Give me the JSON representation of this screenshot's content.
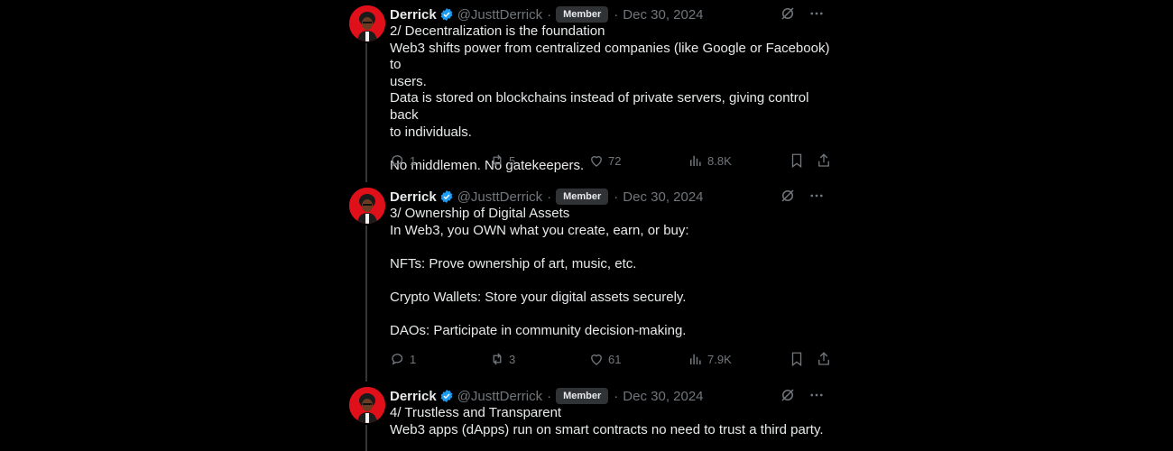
{
  "tweets": [
    {
      "name": "Derrick",
      "handle": "@JusttDerrick",
      "badge": "Member",
      "date": "Dec 30, 2024",
      "lines": [
        "2/ Decentralization is the foundation",
        "Web3 shifts power from centralized companies (like Google or Facebook) to",
        "users.",
        "Data is stored on blockchains instead of private servers, giving control back",
        "to individuals.",
        "",
        "No middlemen. No gatekeepers."
      ],
      "replies": "1",
      "reposts": "5",
      "likes": "72",
      "views": "8.8K"
    },
    {
      "name": "Derrick",
      "handle": "@JusttDerrick",
      "badge": "Member",
      "date": "Dec 30, 2024",
      "lines": [
        "3/ Ownership of Digital Assets",
        "In Web3, you OWN what you create, earn, or buy:",
        "",
        "NFTs: Prove ownership of art, music, etc.",
        "",
        "Crypto Wallets: Store your digital assets securely.",
        "",
        "DAOs: Participate in community decision-making."
      ],
      "replies": "1",
      "reposts": "3",
      "likes": "61",
      "views": "7.9K"
    },
    {
      "name": "Derrick",
      "handle": "@JusttDerrick",
      "badge": "Member",
      "date": "Dec 30, 2024",
      "lines": [
        "4/ Trustless and Transparent",
        "Web3 apps (dApps) run on smart contracts no need to trust a third party."
      ]
    }
  ],
  "separator": "·",
  "colors": {
    "background": "#000000",
    "text": "#e7e9ea",
    "muted": "#71767b",
    "verified": "#1d9bf0",
    "avatar": "#e0101a"
  }
}
